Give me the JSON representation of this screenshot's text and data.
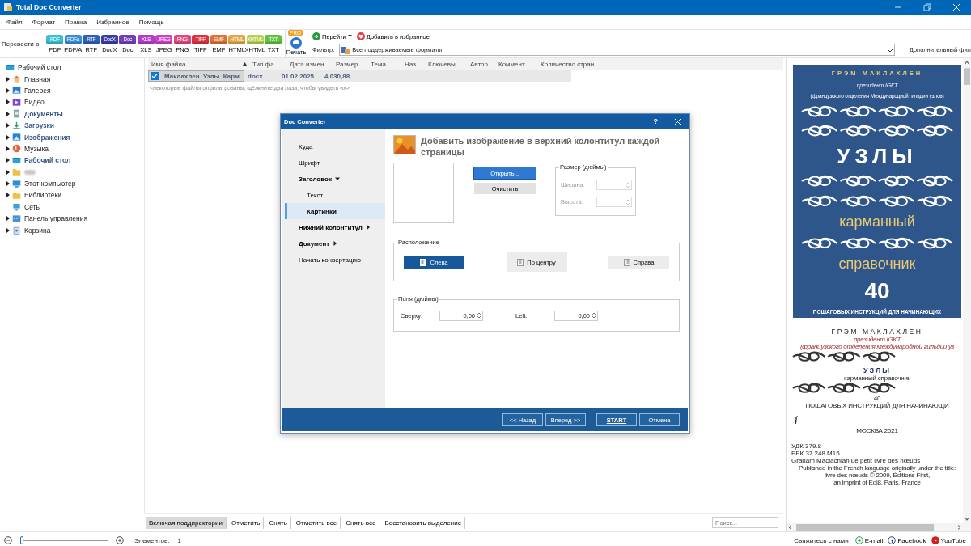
{
  "window": {
    "title": "Total Doc Converter"
  },
  "menu": [
    "Файл",
    "Формат",
    "Правка",
    "Избранное",
    "Помощь"
  ],
  "toolbar": {
    "convert_label": "Перевести в:",
    "formats": [
      {
        "label": "PDF",
        "badge": "PDF",
        "color": "#3cbfd0"
      },
      {
        "label": "PDF/A",
        "badge": "PDFa",
        "color": "#3a8fd6"
      },
      {
        "label": "RTF",
        "badge": "RTF",
        "color": "#2e60b8"
      },
      {
        "label": "DocX",
        "badge": "DocX",
        "color": "#3a3fa8"
      },
      {
        "label": "Doc",
        "badge": "Doc",
        "color": "#7040b8"
      },
      {
        "label": "XLS",
        "badge": "XLS",
        "color": "#b43cc8"
      },
      {
        "label": "JPEG",
        "badge": "JPEG",
        "color": "#c844c4"
      },
      {
        "label": "PNG",
        "badge": "PNG",
        "color": "#e04880"
      },
      {
        "label": "TIFF",
        "badge": "TIFF",
        "color": "#d83444"
      },
      {
        "label": "EMF",
        "badge": "EMF",
        "color": "#e07038"
      },
      {
        "label": "HTML",
        "badge": "HTML",
        "color": "#e0a848"
      },
      {
        "label": "XHTML",
        "badge": "XHTML",
        "color": "#b8d050"
      },
      {
        "label": "TXT",
        "badge": "TXT",
        "color": "#64c040"
      }
    ],
    "print": {
      "label": "Печать",
      "badge": "PRO"
    },
    "goto": "Перейти",
    "favorite": "Добавить в избранное",
    "filter_label": "Фильтр:",
    "filter_value": "Все поддерживаемые форматы",
    "extra_filter": "Дополнительный фил"
  },
  "tree": [
    {
      "label": "Рабочий стол",
      "kind": "desktop",
      "expandable": false,
      "highlighted": false,
      "children": [
        {
          "label": "Главная",
          "kind": "home",
          "expandable": true,
          "highlighted": false
        },
        {
          "label": "Галерея",
          "kind": "gallery",
          "expandable": true,
          "highlighted": false
        },
        {
          "label": "Видео",
          "kind": "video",
          "expandable": true,
          "highlighted": false
        },
        {
          "label": "Документы",
          "kind": "docs",
          "expandable": true,
          "highlighted": true
        },
        {
          "label": "Загрузки",
          "kind": "download",
          "expandable": true,
          "highlighted": true
        },
        {
          "label": "Изображения",
          "kind": "images",
          "expandable": true,
          "highlighted": true
        },
        {
          "label": "Музыка",
          "kind": "music",
          "expandable": true,
          "highlighted": false
        },
        {
          "label": "Рабочий стол",
          "kind": "desktop",
          "expandable": true,
          "highlighted": true
        },
        {
          "kind": "folder",
          "expandable": true,
          "highlighted": false,
          "blurred": true
        },
        {
          "label": "Этот компьютер",
          "kind": "computer",
          "expandable": true,
          "highlighted": false
        },
        {
          "label": "Библиотеки",
          "kind": "folder",
          "expandable": true,
          "highlighted": false
        },
        {
          "label": "Сеть",
          "kind": "network",
          "expandable": false,
          "highlighted": false
        },
        {
          "label": "Панель управления",
          "kind": "control",
          "expandable": true,
          "highlighted": false
        },
        {
          "label": "Корзина",
          "kind": "trash",
          "expandable": true,
          "highlighted": false
        }
      ]
    }
  ],
  "table": {
    "columns": [
      {
        "label": "Имя файла",
        "sorted": true
      },
      {
        "label": "Тип фа...",
        "sorted": false
      },
      {
        "label": "Дата измен...",
        "sorted": false
      },
      {
        "label": "Размер...",
        "sorted": false
      },
      {
        "label": "Тема",
        "sorted": false
      },
      {
        "label": "Наз...",
        "sorted": false
      },
      {
        "label": "Ключевы...",
        "sorted": false
      },
      {
        "label": "Автор",
        "sorted": false
      },
      {
        "label": "Коммент...",
        "sorted": false
      },
      {
        "label": "Количество стран...",
        "sorted": false
      }
    ],
    "rows": [
      {
        "checked": true,
        "selected": true,
        "cells": [
          "Маклахлен. Узлы. Карм...",
          "docx",
          "01.02.2025 ...",
          "4 030,88..."
        ]
      }
    ],
    "note": "<некоторые файлы отфильтрованы, щёлкните два раза, чтобы увидеть их>"
  },
  "bottom_buttons": [
    {
      "label": "Включая поддиректории",
      "selected": true
    },
    {
      "label": "Отметить",
      "selected": false
    },
    {
      "label": "Снять",
      "selected": false
    },
    {
      "label": "Отметить все",
      "selected": false
    },
    {
      "label": "Снять все",
      "selected": false
    },
    {
      "label": "Восстановить выделение",
      "selected": false
    }
  ],
  "search": {
    "placeholder": "Поиск..."
  },
  "dialog": {
    "title": "Doc Converter",
    "help": "?",
    "nav": [
      {
        "label": "Куда",
        "kind": "item",
        "selected": false
      },
      {
        "label": "Шрифт",
        "kind": "item",
        "selected": false
      },
      {
        "label": "Заголовок",
        "kind": "group",
        "expanded": true,
        "selected": false,
        "children": [
          {
            "label": "Текст",
            "selected": false
          },
          {
            "label": "Картинки",
            "selected": true
          }
        ]
      },
      {
        "label": "Нижний колонтитул",
        "kind": "group",
        "expanded": false,
        "selected": false
      },
      {
        "label": "Документ",
        "kind": "group",
        "expanded": false,
        "selected": false
      },
      {
        "label": "Начать конвертацию",
        "kind": "item",
        "selected": false
      }
    ],
    "heading": "Добавить изображение в верхний колонтитул каждой страницы",
    "open_button": "Открыть...",
    "clear_button": "Очистить",
    "size_group": {
      "title": "Размер (дюймы)",
      "fields": [
        {
          "label": "Ширина:",
          "disabled": true
        },
        {
          "label": "Высота:",
          "disabled": true
        }
      ]
    },
    "position_group": {
      "title": "Расположение",
      "options": [
        {
          "label": "Слева",
          "selected": true
        },
        {
          "label": "По центру",
          "selected": false
        },
        {
          "label": "Справа",
          "selected": false
        }
      ]
    },
    "margins_group": {
      "title": "Поля (дюймы)",
      "fields": [
        {
          "label": "Сверху:",
          "value": "0,00",
          "disabled": false
        },
        {
          "label": "Left:",
          "value": "0,00",
          "disabled": false
        }
      ]
    },
    "footer": [
      {
        "label": "<< Назад",
        "kind": "nav"
      },
      {
        "label": "Вперед >>",
        "kind": "nav"
      },
      {
        "label": "START",
        "kind": "primary"
      },
      {
        "label": "Отмена",
        "kind": "nav"
      }
    ]
  },
  "preview": {
    "cover": [
      {
        "kind": "author",
        "text": "ГРЭМ МАКЛАХЛЕН"
      },
      {
        "kind": "subtitle",
        "text": "президент IGKT"
      },
      {
        "kind": "small",
        "text": "(французского отделения Международной гильдии узлов)"
      },
      {
        "kind": "knots"
      },
      {
        "kind": "knots"
      },
      {
        "kind": "title",
        "text": "УЗЛЫ"
      },
      {
        "kind": "knots"
      },
      {
        "kind": "knots"
      },
      {
        "kind": "gold",
        "text": "карманный"
      },
      {
        "kind": "knots"
      },
      {
        "kind": "gold",
        "text": "справочник"
      },
      {
        "kind": "number",
        "text": "40"
      },
      {
        "kind": "caps",
        "text": "ПОШАГОВЫХ ИНСТРУКЦИЙ ДЛЯ НАЧИНАЮЩИХ"
      }
    ],
    "page": [
      {
        "kind": "author",
        "text": "ГРЭМ МАКЛАХЛЕН"
      },
      {
        "kind": "italic",
        "text": "президент IGKT"
      },
      {
        "kind": "italic",
        "text": "(французского отделения Международной гильдии уз"
      },
      {
        "kind": "knots"
      },
      {
        "kind": "title",
        "text": "УЗЛЫ"
      },
      {
        "kind": "center",
        "text": "карманный справочник"
      },
      {
        "kind": "knots"
      },
      {
        "kind": "center",
        "text": "40"
      },
      {
        "kind": "center",
        "text": "ПОШАГОВЫХ ИНСТРУКЦИЙ ДЛЯ НАЧИНАЮЩИ"
      },
      {
        "kind": "emblem"
      },
      {
        "kind": "center",
        "text": "МОСКВА 2021"
      },
      {
        "kind": "left",
        "text": "УДК 379.8"
      },
      {
        "kind": "left",
        "text": "ББК 37.248 M15"
      },
      {
        "kind": "left",
        "text": "Graham Maclachlan Le petit livre des nœuds"
      },
      {
        "kind": "center",
        "text": "Published in the French language originally under the title:"
      },
      {
        "kind": "center",
        "text": "livre des nœuds © 2009, Éditions First,"
      },
      {
        "kind": "center",
        "text": "an imprint of Edi8, Paris, France"
      }
    ]
  },
  "status_bar": {
    "zoom": {
      "level": 0.0
    },
    "items_label": "Элементов:",
    "items_count": "1",
    "contact": "Свяжитесь с нами",
    "links": [
      {
        "label": "E-mail",
        "kind": "email"
      },
      {
        "label": "Facebook",
        "kind": "facebook"
      },
      {
        "label": "YouTube",
        "kind": "youtube"
      }
    ]
  }
}
